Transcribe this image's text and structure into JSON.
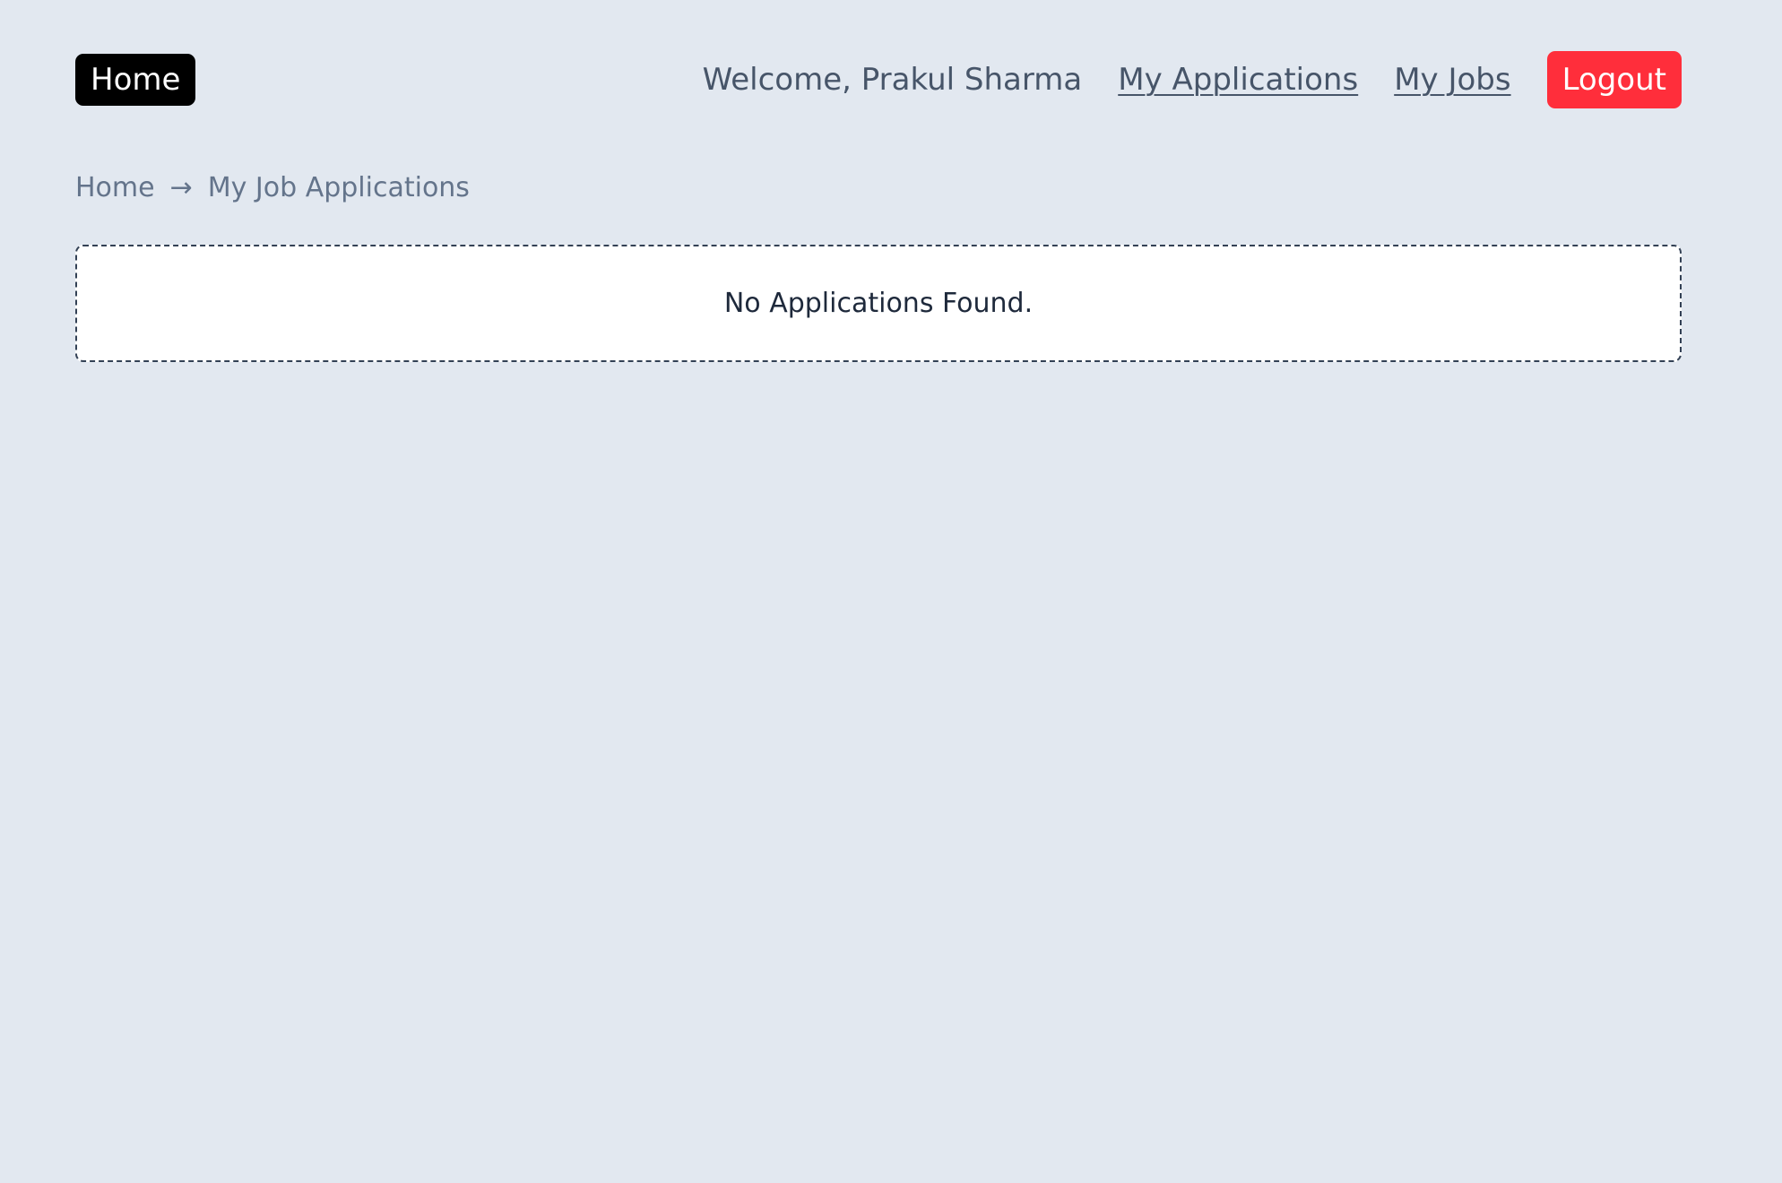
{
  "nav": {
    "home_label": "Home",
    "welcome_text": "Welcome, Prakul Sharma",
    "my_applications_label": "My Applications",
    "my_jobs_label": "My Jobs",
    "logout_label": "Logout"
  },
  "breadcrumb": {
    "home_label": "Home",
    "separator": "→",
    "current_label": "My Job Applications"
  },
  "content": {
    "empty_message": "No Applications Found."
  },
  "colors": {
    "background": "#e2e8f0",
    "logout_button": "#ff2e3b",
    "home_button": "#000000"
  }
}
